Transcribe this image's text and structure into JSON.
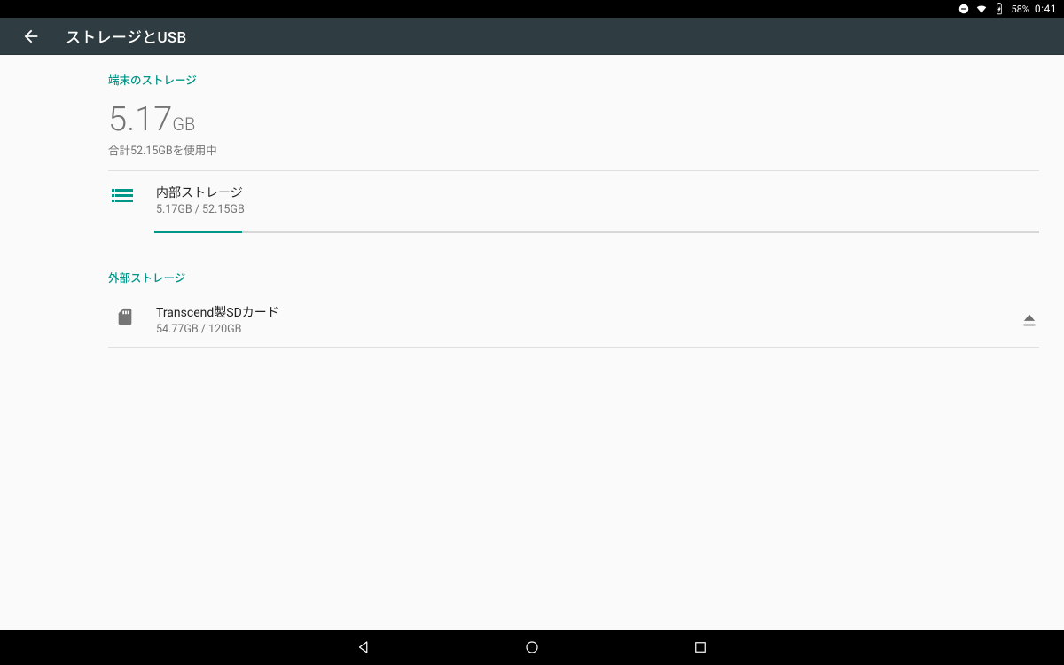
{
  "status": {
    "battery_pct": "58%",
    "clock": "0:41"
  },
  "appbar": {
    "title": "ストレージとUSB"
  },
  "device_storage": {
    "header": "端末のストレージ",
    "used_value": "5.17",
    "used_unit": "GB",
    "summary_sub": "合計52.15GBを使用中",
    "internal": {
      "name": "内部ストレージ",
      "detail": "5.17GB / 52.15GB",
      "fill_pct": 9.9
    }
  },
  "external_storage": {
    "header": "外部ストレージ",
    "card": {
      "name": "Transcend製SDカード",
      "detail": "54.77GB / 120GB"
    }
  }
}
